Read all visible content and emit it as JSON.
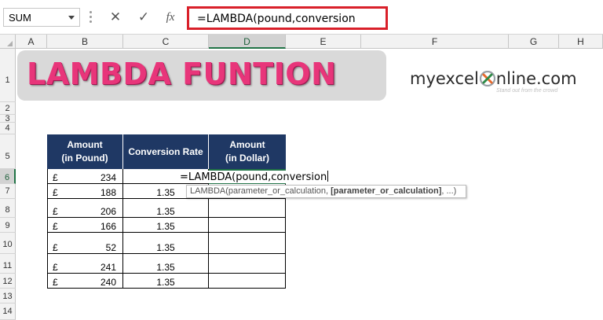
{
  "formula_bar": {
    "name_box": "SUM",
    "cancel_icon": "✕",
    "enter_icon": "✓",
    "fx_label": "fx",
    "formula": "=LAMBDA(pound,conversion"
  },
  "columns": [
    "A",
    "B",
    "C",
    "D",
    "E",
    "F",
    "G",
    "H"
  ],
  "rows": [
    "1",
    "2",
    "3",
    "4",
    "5",
    "6",
    "7",
    "8",
    "9",
    "10",
    "11",
    "12",
    "13",
    "14"
  ],
  "banner": {
    "title": "LAMBDA FUNTION"
  },
  "logo": {
    "text_left": "myexcel",
    "text_right": "nline.com",
    "tagline": "Stand out from the crowd"
  },
  "table": {
    "headers": [
      {
        "line1": "Amount",
        "line2": "(in Pound)"
      },
      {
        "line1": "Conversion Rate",
        "line2": ""
      },
      {
        "line1": "Amount",
        "line2": "(in Dollar)"
      }
    ],
    "currency_symbol": "£",
    "rows": [
      {
        "amount": "234",
        "rate": ""
      },
      {
        "amount": "188",
        "rate": "1.35"
      },
      {
        "amount": "206",
        "rate": "1.35"
      },
      {
        "amount": "166",
        "rate": "1.35"
      },
      {
        "amount": "52",
        "rate": "1.35"
      },
      {
        "amount": "241",
        "rate": "1.35"
      },
      {
        "amount": "240",
        "rate": "1.35"
      }
    ]
  },
  "active_cell_edit": "=LAMBDA(pound,conversion",
  "tooltip": {
    "prefix": "LAMBDA(parameter_or_calculation, ",
    "bold": "[parameter_or_calculation]",
    "suffix": ", ...)"
  },
  "colors": {
    "accent": "#217346",
    "header_fill": "#1f3864",
    "highlight": "#d9202a",
    "title": "#e8357a"
  }
}
